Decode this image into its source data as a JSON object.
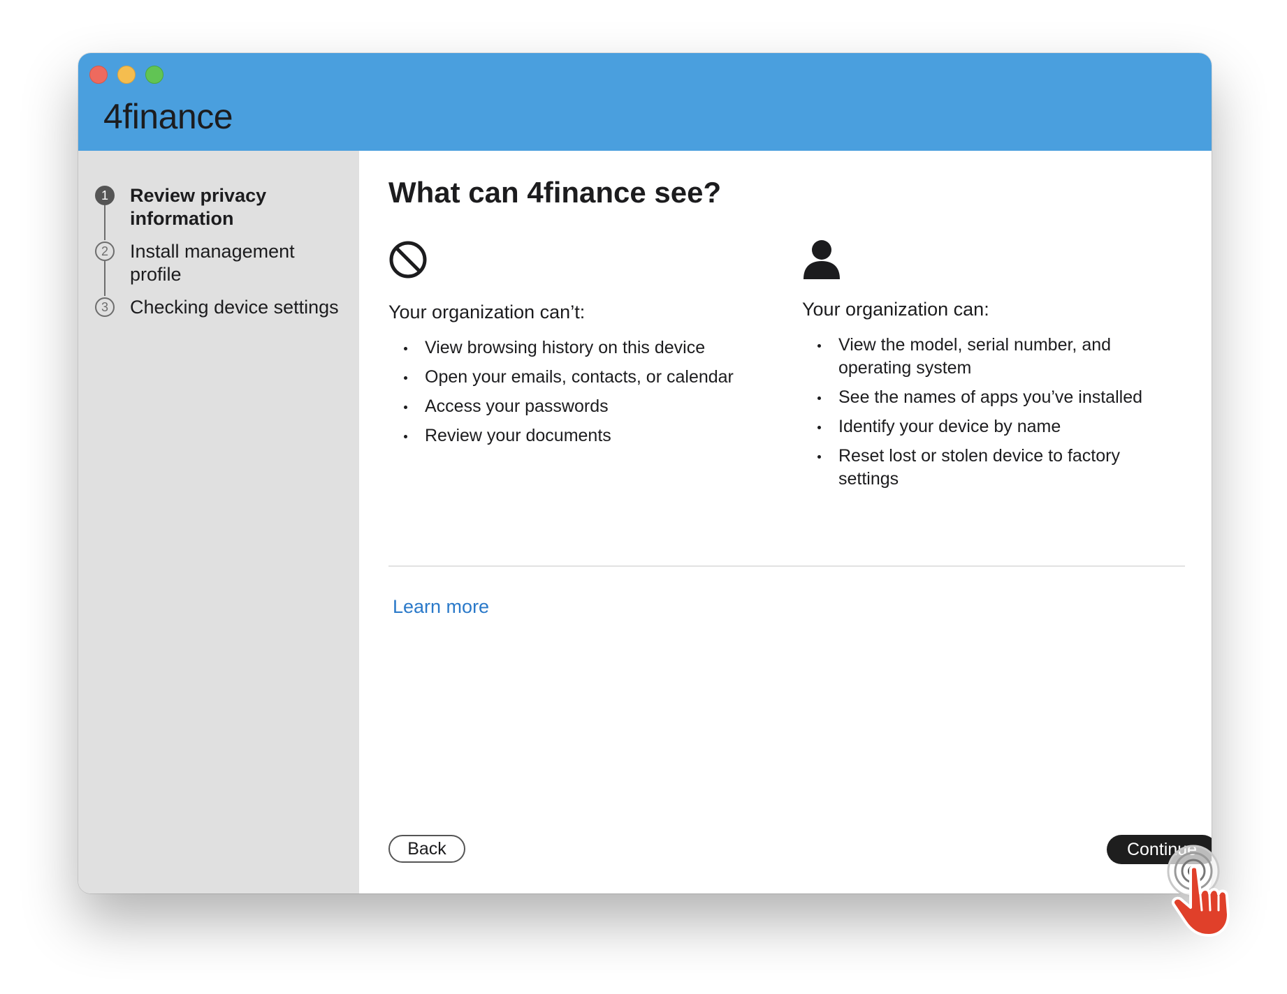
{
  "window": {
    "app_title": "4finance"
  },
  "sidebar": {
    "steps": [
      {
        "number": "1",
        "label": "Review privacy information",
        "active": true
      },
      {
        "number": "2",
        "label": "Install management profile",
        "active": false
      },
      {
        "number": "3",
        "label": "Checking device settings",
        "active": false
      }
    ]
  },
  "main": {
    "heading": "What can 4finance see?",
    "cant": {
      "icon": "prohibited-icon",
      "title": "Your organization can’t:",
      "items": [
        "View browsing history on this device",
        "Open your emails, contacts, or calendar",
        "Access your passwords",
        "Review your documents"
      ]
    },
    "can": {
      "icon": "person-icon",
      "title": "Your organization can:",
      "items": [
        "View the model, serial number, and operating system",
        "See the names of apps you’ve installed",
        "Identify your device by name",
        "Reset lost or stolen device to factory settings"
      ]
    },
    "learn_more": "Learn more"
  },
  "footer": {
    "back_label": "Back",
    "continue_label": "Continue"
  },
  "colors": {
    "titlebar": "#4a9fde",
    "sidebar": "#e0e0e0",
    "link": "#2a79c9",
    "primary_button": "#1e1e1e",
    "cursor_hand": "#e0402a"
  }
}
